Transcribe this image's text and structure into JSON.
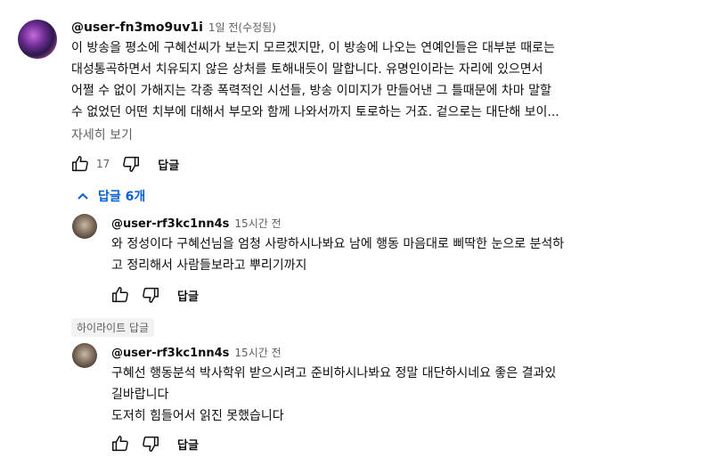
{
  "comment": {
    "author": "@user-fn3mo9uv1i",
    "time": "1일 전(수정됨)",
    "lines": [
      "이 방송을 평소에 구혜선씨가 보는지 모르겠지만, 이 방송에 나오는 연예인들은 대부분 때로는",
      "대성통곡하면서 치유되지 않은 상처를 토해내듯이 말합니다. 유명인이라는 자리에 있으면서",
      "어쩔 수 없이 가해지는 각종 폭력적인 시선들, 방송 이미지가 만들어낸 그 틀때문에 차마 말할",
      "수 없었던 어떤 치부에 대해서 부모와 함께 나와서까지 토로하는 거죠. 겉으로는 대단해 보이..."
    ],
    "read_more": "자세히 보기",
    "likes": "17",
    "reply_label": "답글",
    "replies_toggle": "답글 6개"
  },
  "replies": [
    {
      "author": "@user-rf3kc1nn4s",
      "time": "15시간 전",
      "lines": [
        "와 정성이다 구혜선님을 엄청 사랑하시나봐요 남에 행동 마음대로 삐딱한 눈으로 분석하",
        "고 정리해서 사람들보라고 뿌리기까지"
      ],
      "reply_label": "답글"
    },
    {
      "highlight": "하이라이트 답글",
      "author": "@user-rf3kc1nn4s",
      "time": "15시간 전",
      "lines": [
        "구혜선 행동분석 박사학위 받으시려고 준비하시나봐요 정말 대단하시네요 좋은 결과있",
        "길바랍니다",
        "도저히 힘들어서 읽진 못했습니다"
      ],
      "reply_label": "답글"
    }
  ]
}
